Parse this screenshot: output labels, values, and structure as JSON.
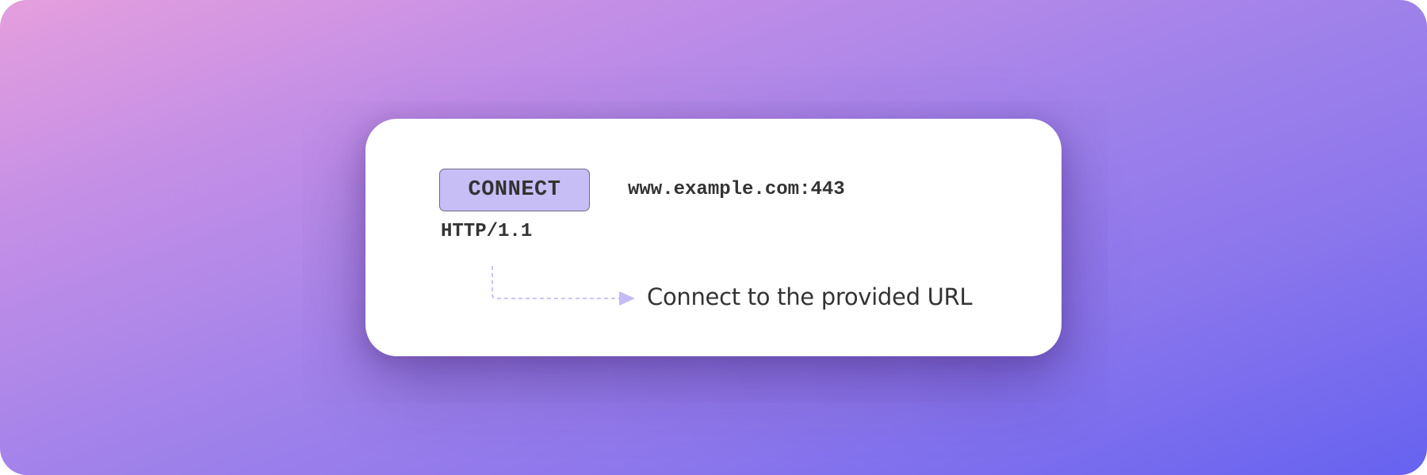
{
  "request_line": {
    "method": "CONNECT",
    "target": "www.example.com:443",
    "version": "HTTP/1.1"
  },
  "annotation": {
    "text": "Connect to the provided URL"
  },
  "colors": {
    "badge_fill": "#c8bef6",
    "badge_border": "#6f6a82",
    "connector": "#c4bcf5",
    "text": "#333333",
    "card": "#ffffff",
    "background_start": "#e59fdd",
    "background_end": "#6662f0"
  }
}
